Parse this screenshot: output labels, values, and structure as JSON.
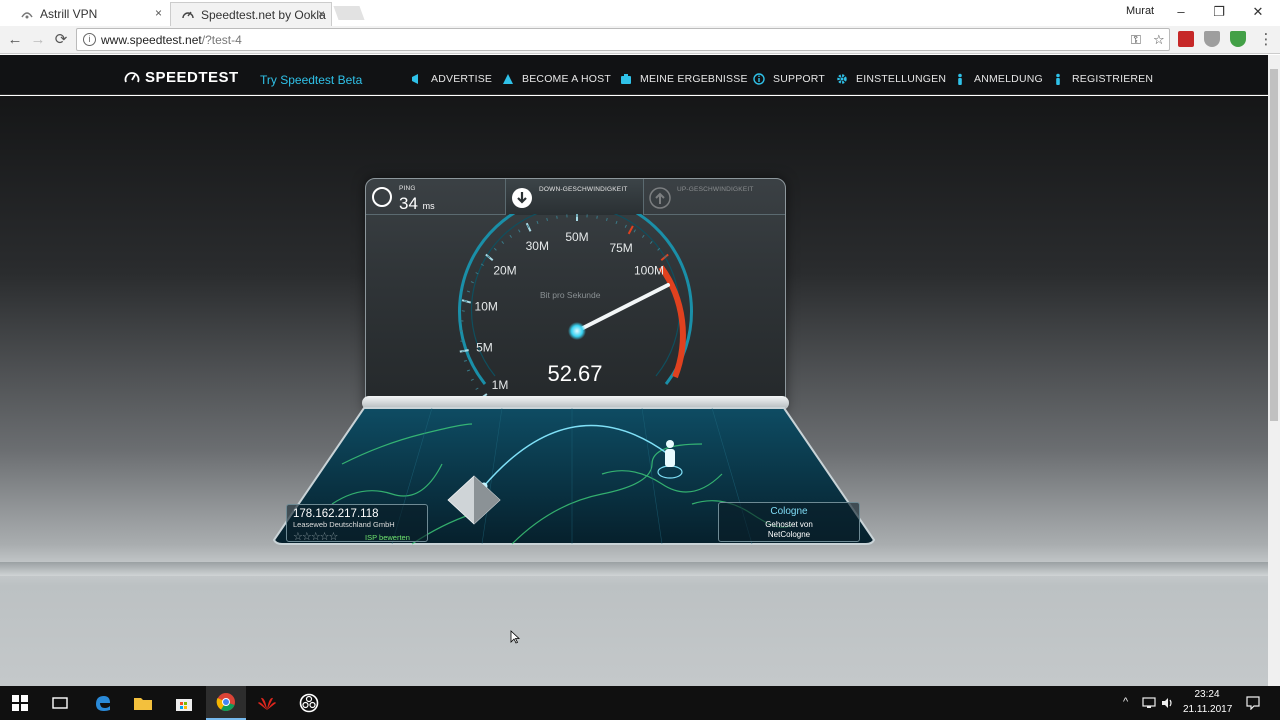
{
  "browser": {
    "tabs": [
      {
        "title": "Astrill VPN",
        "close": "×"
      },
      {
        "title": "Speedtest.net by Ookla",
        "close": "×"
      }
    ],
    "user_label": "Murat",
    "window_controls": {
      "minimize": "–",
      "restore": "❐",
      "close": "✕"
    },
    "nav": {
      "back": "←",
      "forward": "→",
      "reload": "⟳"
    },
    "url": {
      "host": "www.speedtest.net",
      "path": "/?test-4"
    },
    "omnibox_icons": {
      "key": "⚿",
      "star": "☆"
    },
    "menu": "⋮"
  },
  "site": {
    "logo": "SPEEDTEST",
    "beta_link": "Try Speedtest Beta",
    "nav": [
      {
        "label": "ADVERTISE",
        "icon": "megaphone-icon"
      },
      {
        "label": "BECOME A HOST",
        "icon": "triangle-icon"
      },
      {
        "label": "MEINE ERGEBNISSE",
        "icon": "results-icon"
      },
      {
        "label": "SUPPORT",
        "icon": "info-icon"
      },
      {
        "label": "EINSTELLUNGEN",
        "icon": "gear-icon"
      },
      {
        "label": "ANMELDUNG",
        "icon": "person-icon"
      },
      {
        "label": "REGISTRIEREN",
        "icon": "person-icon"
      }
    ]
  },
  "test": {
    "ping": {
      "label": "PING",
      "value": "34",
      "unit": "ms"
    },
    "download_label": "DOWN-GESCHWINDIGKEIT",
    "upload_label": "UP-GESCHWINDIGKEIT",
    "gauge_unit_label": "Bit pro Sekunde",
    "gauge_ticks": [
      "0",
      "1M",
      "5M",
      "10M",
      "20M",
      "30M",
      "50M",
      "75M",
      "100M"
    ],
    "current_speed": "52.67",
    "current_speed_numeric": 52.67,
    "client": {
      "ip": "178.162.217.118",
      "isp": "Leaseweb Deutschland GmbH",
      "stars": "☆☆☆☆☆",
      "rate_label": "ISP bewerten"
    },
    "server": {
      "city": "Cologne",
      "hosted_by": "Gehostet von",
      "org": "NetCologne"
    }
  },
  "taskbar": {
    "time": "23:24",
    "date": "21.11.2017",
    "apps": [
      "start",
      "task-view",
      "edge",
      "explorer",
      "store",
      "chrome",
      "huawei",
      "obs"
    ]
  }
}
